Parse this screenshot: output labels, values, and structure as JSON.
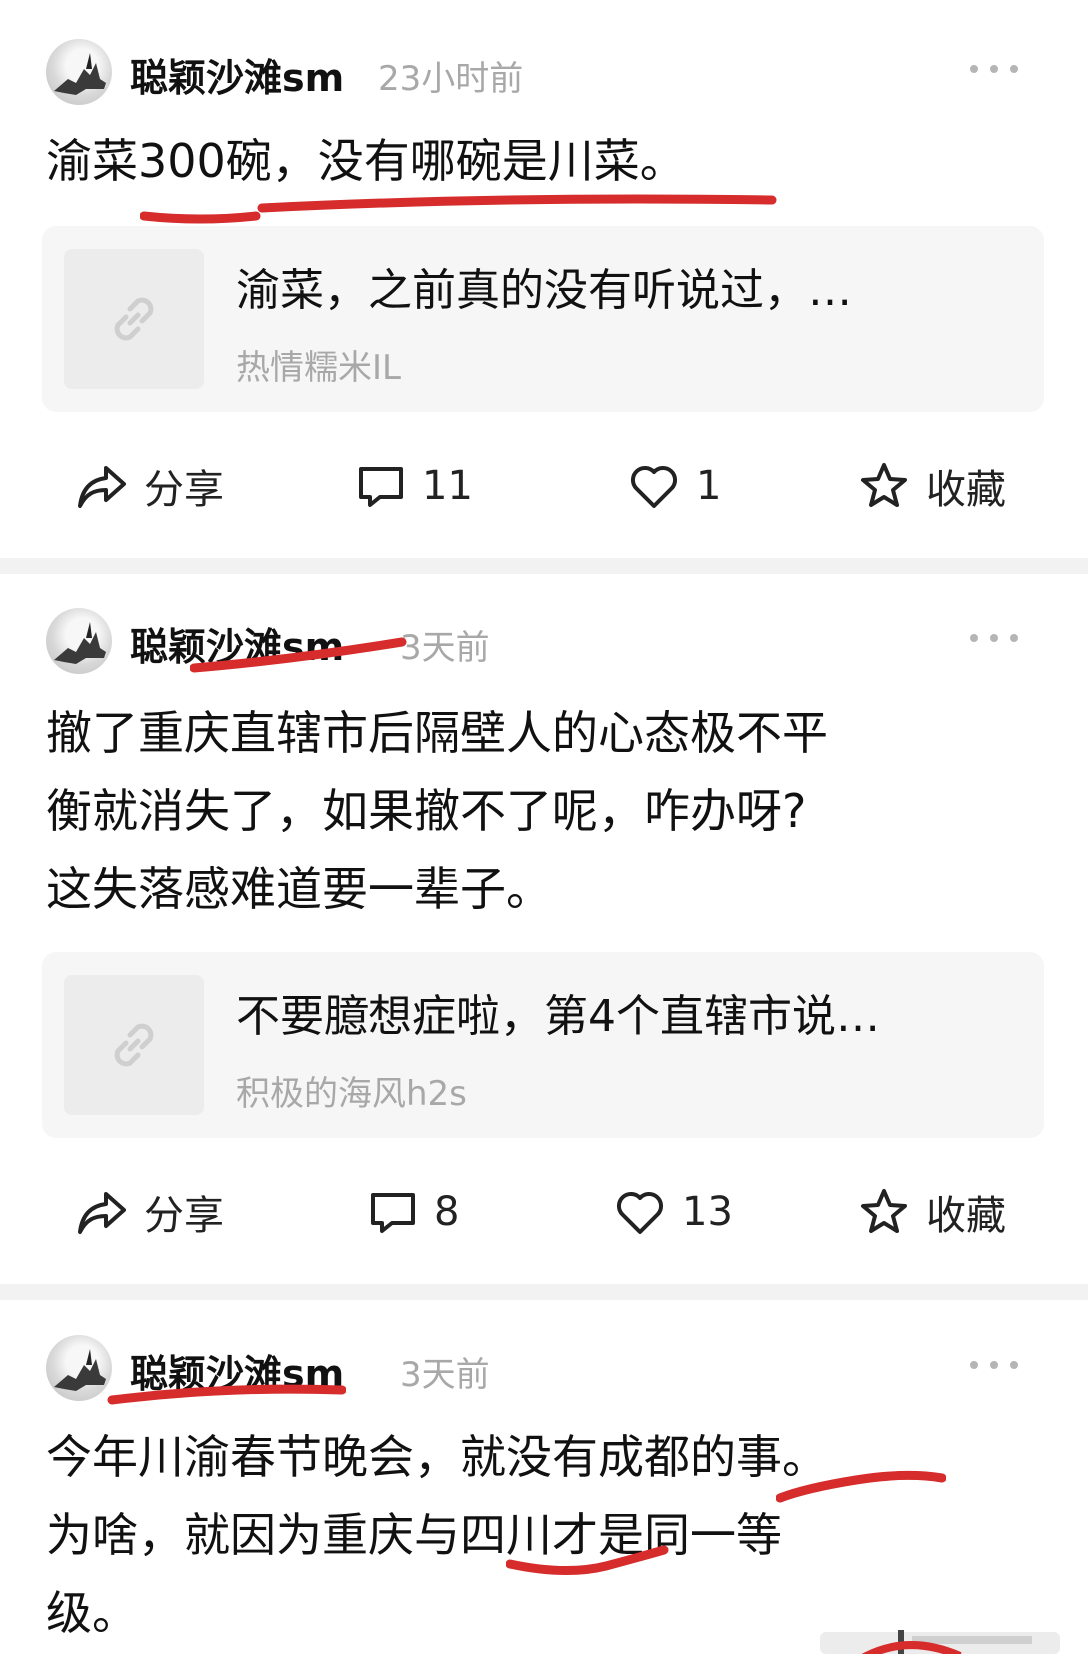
{
  "posts": [
    {
      "username": "聪颖沙滩sm",
      "time": "23小时前",
      "content_lines": [
        "渝菜300碗，没有哪碗是川菜。"
      ],
      "link": {
        "title": "渝菜，之前真的没有听说过，…",
        "author": "热情糯米IL"
      },
      "actions": {
        "share": "分享",
        "comments": "11",
        "likes": "1",
        "favorite": "收藏"
      }
    },
    {
      "username": "聪颖沙滩sm",
      "time": "3天前",
      "content_lines": [
        "撤了重庆直辖市后隔壁人的心态极不平",
        "衡就消失了，如果撤不了呢，咋办呀?",
        "这失落感难道要一辈子。"
      ],
      "link": {
        "title": "不要臆想症啦，第4个直辖市说…",
        "author": "积极的海风h2s"
      },
      "actions": {
        "share": "分享",
        "comments": "8",
        "likes": "13",
        "favorite": "收藏"
      }
    },
    {
      "username": "聪颖沙滩sm",
      "time": "3天前",
      "content_lines": [
        "今年川渝春节晚会，就没有成都的事。",
        "为啥，就因为重庆与四川才是同一等",
        "级。"
      ]
    }
  ],
  "colors": {
    "underline": "#d62c2c",
    "muted": "#a8a8a8",
    "card": "#f6f6f6",
    "separator": "#f2f2f2"
  },
  "icons": [
    "more-icon",
    "link-icon",
    "share-icon",
    "comment-icon",
    "heart-icon",
    "star-icon",
    "avatar"
  ]
}
